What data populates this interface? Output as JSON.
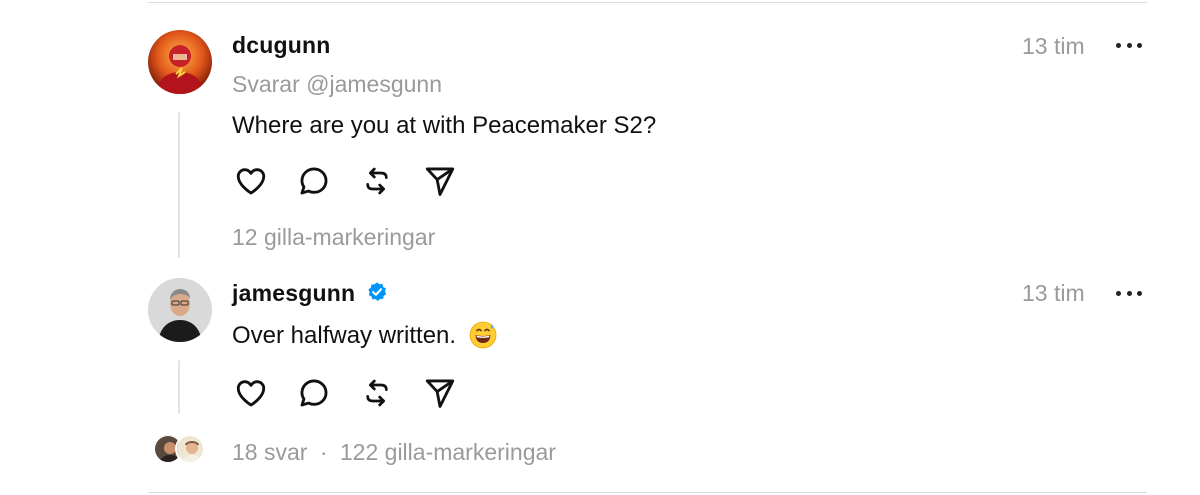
{
  "posts": [
    {
      "username": "dcugunn",
      "reply_to": "Svarar @jamesgunn",
      "text": "Where are you at with Peacemaker S2?",
      "timestamp": "13 tim",
      "likes": "12 gilla-markeringar",
      "verified": false,
      "avatar_icon": "flash-avatar"
    },
    {
      "username": "jamesgunn",
      "text": "Over halfway written.",
      "emoji": "grinning-sweat-emoji",
      "timestamp": "13 tim",
      "replies": "18 svar",
      "separator": "·",
      "likes": "122 gilla-markeringar",
      "verified": true,
      "avatar_icon": "person-avatar"
    }
  ],
  "icons": {
    "like": "heart-icon",
    "comment": "comment-icon",
    "repost": "repost-icon",
    "share": "send-icon",
    "more": "more-icon"
  },
  "colors": {
    "verified": "#0095f6",
    "muted": "#9a9a9a",
    "text": "#111111"
  }
}
